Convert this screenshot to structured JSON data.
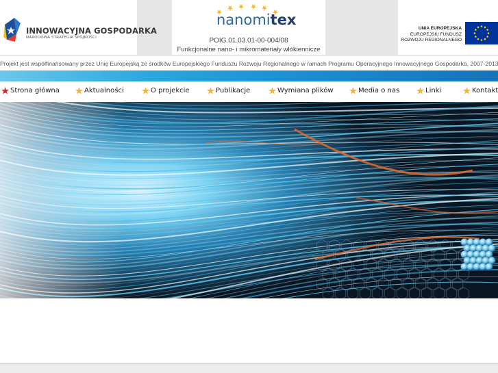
{
  "header": {
    "ig_title": "INNOWACYJNA GOSPODARKA",
    "ig_subtitle": "NARODOWA STRATEGIA SPÓJNOŚCI",
    "project_brand_prefix": "nanomi",
    "project_brand_suffix": "tex",
    "project_code": "POIG.01.03.01-00-004/08",
    "project_description": "Funkcjonalne nano- i mikromateriały włókiennicze",
    "eu_line1": "UNIA EUROPEJSKA",
    "eu_line2": "EUROPEJSKI FUNDUSZ",
    "eu_line3": "ROZWOJU REGIONALNEGO"
  },
  "disclaimer": "Projekt jest współfinansowany przez Unię Europejską ze środków Europejskiego Funduszu Rozwoju Regionalnego w ramach Programu Operacyjnego Innowacyjnego Gospodarka, 2007-2013",
  "nav": {
    "items": [
      {
        "label": "Strona główna",
        "active": true
      },
      {
        "label": "Aktualności",
        "active": false
      },
      {
        "label": "O projekcie",
        "active": false
      },
      {
        "label": "Publikacje",
        "active": false
      },
      {
        "label": "Wymiana plików",
        "active": false
      },
      {
        "label": "Media o nas",
        "active": false
      },
      {
        "label": "Linki",
        "active": false
      },
      {
        "label": "Kontakt",
        "active": false
      }
    ]
  },
  "colors": {
    "brand_blue": "#2b6aa0",
    "bar_blue": "#1b8fd0",
    "star_active": "#d42a2a",
    "star_inactive": "#f2b632",
    "eu_blue": "#003399",
    "eu_star": "#ffcc00"
  }
}
